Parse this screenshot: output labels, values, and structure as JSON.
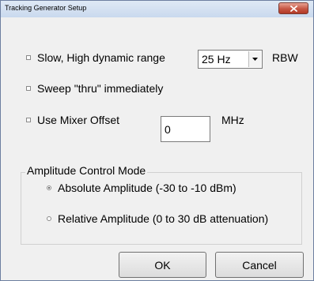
{
  "window": {
    "title": "Tracking Generator Setup",
    "close_icon": "close-icon"
  },
  "options": {
    "slow_label": "Slow, High dynamic range",
    "slow_checked": false,
    "rbw_value": "25 Hz",
    "rbw_unit": "RBW",
    "sweep_label": "Sweep \"thru\" immediately",
    "sweep_checked": false,
    "mixer_label": "Use Mixer Offset",
    "mixer_checked": false,
    "mixer_value": "0",
    "mixer_unit": "MHz"
  },
  "amplitude": {
    "group_label": "Amplitude Control Mode",
    "absolute_label": "Absolute Amplitude (-30 to -10 dBm)",
    "absolute_selected": true,
    "relative_label": "Relative Amplitude (0 to 30 dB attenuation)",
    "relative_selected": false
  },
  "buttons": {
    "ok_label": "OK",
    "cancel_label": "Cancel"
  },
  "colors": {
    "close_button": "#c65644",
    "dialog_background": "#f0f0f0"
  }
}
